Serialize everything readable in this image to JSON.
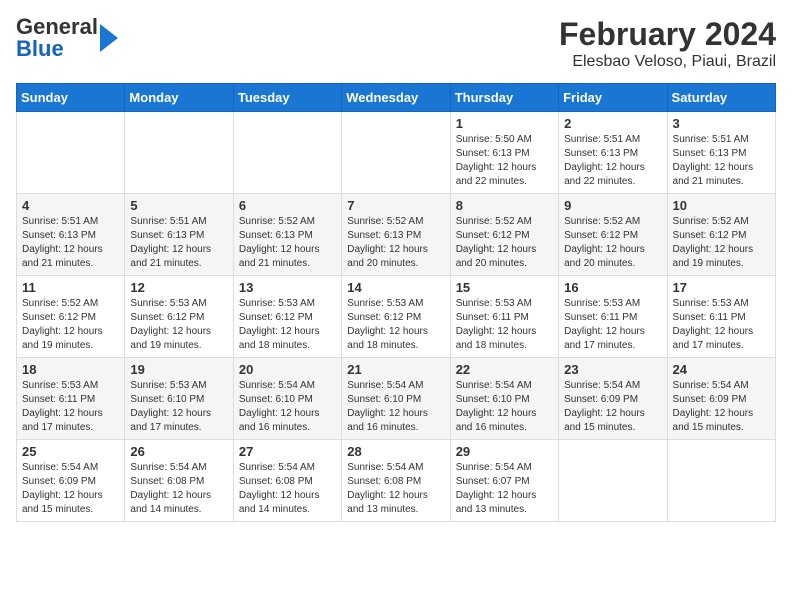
{
  "header": {
    "logo_general": "General",
    "logo_blue": "Blue",
    "title": "February 2024",
    "subtitle": "Elesbao Veloso, Piaui, Brazil"
  },
  "weekdays": [
    "Sunday",
    "Monday",
    "Tuesday",
    "Wednesday",
    "Thursday",
    "Friday",
    "Saturday"
  ],
  "weeks": [
    [
      {
        "day": "",
        "info": ""
      },
      {
        "day": "",
        "info": ""
      },
      {
        "day": "",
        "info": ""
      },
      {
        "day": "",
        "info": ""
      },
      {
        "day": "1",
        "info": "Sunrise: 5:50 AM\nSunset: 6:13 PM\nDaylight: 12 hours and 22 minutes."
      },
      {
        "day": "2",
        "info": "Sunrise: 5:51 AM\nSunset: 6:13 PM\nDaylight: 12 hours and 22 minutes."
      },
      {
        "day": "3",
        "info": "Sunrise: 5:51 AM\nSunset: 6:13 PM\nDaylight: 12 hours and 21 minutes."
      }
    ],
    [
      {
        "day": "4",
        "info": "Sunrise: 5:51 AM\nSunset: 6:13 PM\nDaylight: 12 hours and 21 minutes."
      },
      {
        "day": "5",
        "info": "Sunrise: 5:51 AM\nSunset: 6:13 PM\nDaylight: 12 hours and 21 minutes."
      },
      {
        "day": "6",
        "info": "Sunrise: 5:52 AM\nSunset: 6:13 PM\nDaylight: 12 hours and 21 minutes."
      },
      {
        "day": "7",
        "info": "Sunrise: 5:52 AM\nSunset: 6:13 PM\nDaylight: 12 hours and 20 minutes."
      },
      {
        "day": "8",
        "info": "Sunrise: 5:52 AM\nSunset: 6:12 PM\nDaylight: 12 hours and 20 minutes."
      },
      {
        "day": "9",
        "info": "Sunrise: 5:52 AM\nSunset: 6:12 PM\nDaylight: 12 hours and 20 minutes."
      },
      {
        "day": "10",
        "info": "Sunrise: 5:52 AM\nSunset: 6:12 PM\nDaylight: 12 hours and 19 minutes."
      }
    ],
    [
      {
        "day": "11",
        "info": "Sunrise: 5:52 AM\nSunset: 6:12 PM\nDaylight: 12 hours and 19 minutes."
      },
      {
        "day": "12",
        "info": "Sunrise: 5:53 AM\nSunset: 6:12 PM\nDaylight: 12 hours and 19 minutes."
      },
      {
        "day": "13",
        "info": "Sunrise: 5:53 AM\nSunset: 6:12 PM\nDaylight: 12 hours and 18 minutes."
      },
      {
        "day": "14",
        "info": "Sunrise: 5:53 AM\nSunset: 6:12 PM\nDaylight: 12 hours and 18 minutes."
      },
      {
        "day": "15",
        "info": "Sunrise: 5:53 AM\nSunset: 6:11 PM\nDaylight: 12 hours and 18 minutes."
      },
      {
        "day": "16",
        "info": "Sunrise: 5:53 AM\nSunset: 6:11 PM\nDaylight: 12 hours and 17 minutes."
      },
      {
        "day": "17",
        "info": "Sunrise: 5:53 AM\nSunset: 6:11 PM\nDaylight: 12 hours and 17 minutes."
      }
    ],
    [
      {
        "day": "18",
        "info": "Sunrise: 5:53 AM\nSunset: 6:11 PM\nDaylight: 12 hours and 17 minutes."
      },
      {
        "day": "19",
        "info": "Sunrise: 5:53 AM\nSunset: 6:10 PM\nDaylight: 12 hours and 17 minutes."
      },
      {
        "day": "20",
        "info": "Sunrise: 5:54 AM\nSunset: 6:10 PM\nDaylight: 12 hours and 16 minutes."
      },
      {
        "day": "21",
        "info": "Sunrise: 5:54 AM\nSunset: 6:10 PM\nDaylight: 12 hours and 16 minutes."
      },
      {
        "day": "22",
        "info": "Sunrise: 5:54 AM\nSunset: 6:10 PM\nDaylight: 12 hours and 16 minutes."
      },
      {
        "day": "23",
        "info": "Sunrise: 5:54 AM\nSunset: 6:09 PM\nDaylight: 12 hours and 15 minutes."
      },
      {
        "day": "24",
        "info": "Sunrise: 5:54 AM\nSunset: 6:09 PM\nDaylight: 12 hours and 15 minutes."
      }
    ],
    [
      {
        "day": "25",
        "info": "Sunrise: 5:54 AM\nSunset: 6:09 PM\nDaylight: 12 hours and 15 minutes."
      },
      {
        "day": "26",
        "info": "Sunrise: 5:54 AM\nSunset: 6:08 PM\nDaylight: 12 hours and 14 minutes."
      },
      {
        "day": "27",
        "info": "Sunrise: 5:54 AM\nSunset: 6:08 PM\nDaylight: 12 hours and 14 minutes."
      },
      {
        "day": "28",
        "info": "Sunrise: 5:54 AM\nSunset: 6:08 PM\nDaylight: 12 hours and 13 minutes."
      },
      {
        "day": "29",
        "info": "Sunrise: 5:54 AM\nSunset: 6:07 PM\nDaylight: 12 hours and 13 minutes."
      },
      {
        "day": "",
        "info": ""
      },
      {
        "day": "",
        "info": ""
      }
    ]
  ]
}
